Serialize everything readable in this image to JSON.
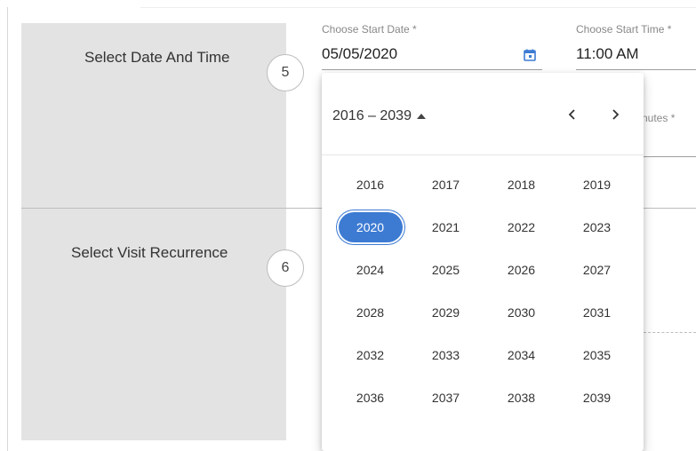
{
  "sections": {
    "date_time": {
      "label": "Select Date And Time",
      "step": "5"
    },
    "visit_recurrence": {
      "label": "Select Visit Recurrence",
      "step": "6"
    }
  },
  "fields": {
    "start_date": {
      "label": "Choose Start Date *",
      "value": "05/05/2020",
      "icon": "calendar-icon"
    },
    "start_time": {
      "label": "Choose Start Time *",
      "value": "11:00 AM"
    },
    "duration": {
      "label": "nutes *"
    }
  },
  "year_picker": {
    "period_label": "2016 – 2039",
    "period_icon": "caret-up-icon",
    "prev_icon": "chevron-left-icon",
    "next_icon": "chevron-right-icon",
    "selected_year": "2020",
    "years": [
      "2016",
      "2017",
      "2018",
      "2019",
      "2020",
      "2021",
      "2022",
      "2023",
      "2024",
      "2025",
      "2026",
      "2027",
      "2028",
      "2029",
      "2030",
      "2031",
      "2032",
      "2033",
      "2034",
      "2035",
      "2036",
      "2037",
      "2038",
      "2039"
    ]
  },
  "colors": {
    "accent": "#3d7bd3",
    "label_column_bg": "#e3e3e3"
  }
}
